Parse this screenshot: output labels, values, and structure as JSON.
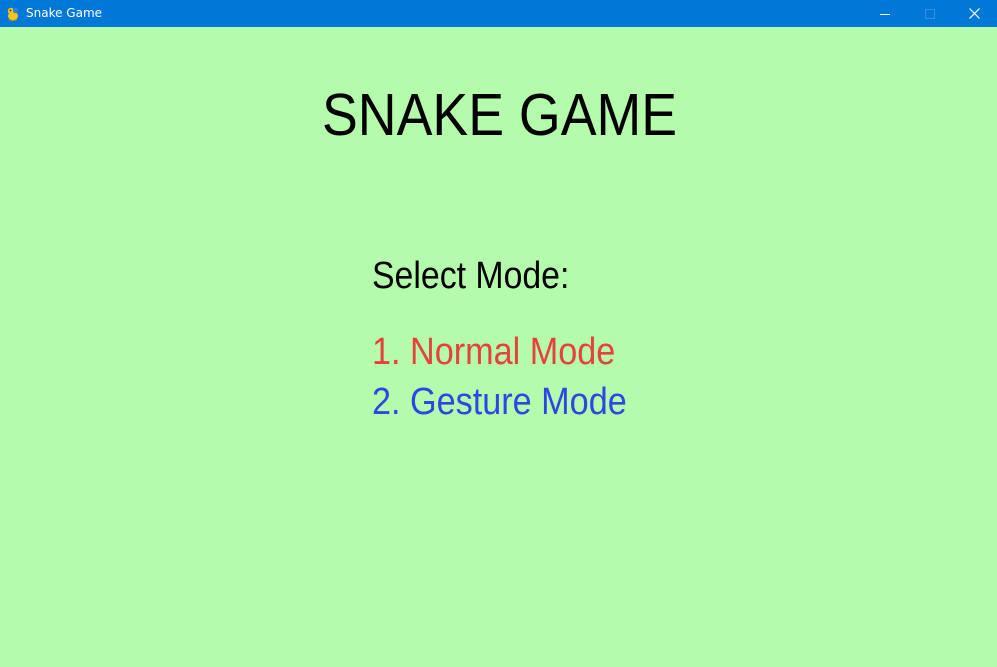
{
  "window": {
    "title": "Snake Game",
    "app_icon": "pygame-snake-icon",
    "controls": {
      "minimize_icon": "minimize-icon",
      "maximize_icon": "maximize-icon",
      "close_icon": "close-icon"
    },
    "titlebar_color": "#0078d7"
  },
  "menu": {
    "background_color": "#b4fcab",
    "title": "SNAKE GAME",
    "select_label": "Select Mode:",
    "options": [
      {
        "label": "1. Normal Mode",
        "color": "#e6413e"
      },
      {
        "label": "2. Gesture Mode",
        "color": "#2f45e6"
      }
    ]
  }
}
